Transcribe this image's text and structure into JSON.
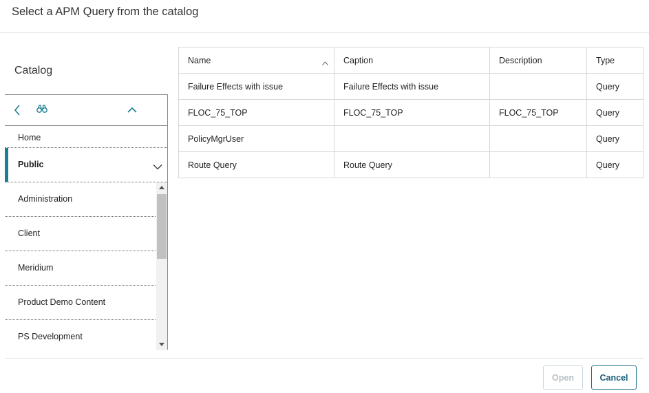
{
  "dialog": {
    "title": "Select a APM Query from the catalog"
  },
  "catalog": {
    "heading": "Catalog",
    "toolbar": {
      "back_icon": "chevron-left-icon",
      "search_icon": "binoculars-icon",
      "collapse_icon": "chevron-up-icon"
    },
    "home_label": "Home",
    "selected_folder": "Public",
    "folders": [
      {
        "label": "Administration"
      },
      {
        "label": "Client"
      },
      {
        "label": "Meridium"
      },
      {
        "label": "Product Demo Content"
      },
      {
        "label": "PS Development"
      }
    ]
  },
  "table": {
    "columns": [
      "Name",
      "Caption",
      "Description",
      "Type"
    ],
    "sorted_column": "Name",
    "sort_direction": "ascending",
    "rows": [
      {
        "name": "Failure Effects with issue",
        "caption": "Failure Effects with issue",
        "description": "",
        "type": "Query"
      },
      {
        "name": "FLOC_75_TOP",
        "caption": "FLOC_75_TOP",
        "description": "FLOC_75_TOP",
        "type": "Query"
      },
      {
        "name": "PolicyMgrUser",
        "caption": "",
        "description": "",
        "type": "Query"
      },
      {
        "name": "Route Query",
        "caption": "Route Query",
        "description": "",
        "type": "Query"
      }
    ]
  },
  "footer": {
    "open_label": "Open",
    "cancel_label": "Cancel"
  },
  "colors": {
    "accent": "#1b7e92",
    "cancel_border": "#1b6f8a",
    "disabled_text": "#b8c2c6"
  }
}
